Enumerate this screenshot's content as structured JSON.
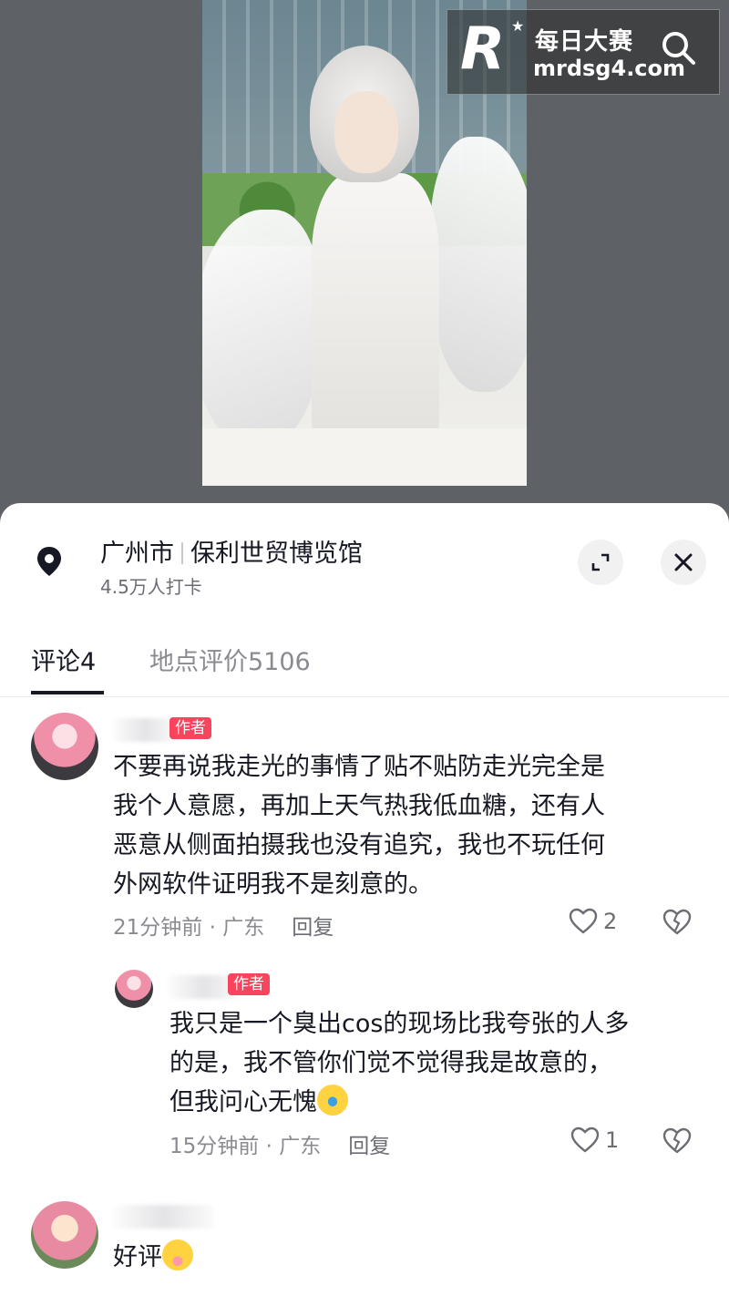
{
  "watermark": {
    "logo_letter": "R",
    "title": "每日大赛",
    "url": "mrdsg4.com"
  },
  "location": {
    "city": "广州市",
    "venue": "保利世贸博览馆",
    "checkins": "4.5万人打卡"
  },
  "tabs": [
    {
      "label": "评论4",
      "active": true
    },
    {
      "label": "地点评价5106",
      "active": false
    }
  ],
  "comments": [
    {
      "badge": "作者",
      "text_lines": [
        "不要再说我走光的事情了贴不贴防走光完全是",
        "我个人意愿，再加上天气热我低血糖，还有人",
        "恶意从侧面拍摄我也没有追究，我也不玩任何",
        "外网软件证明我不是刻意的。"
      ],
      "time": "21分钟前 · 广东",
      "reply_label": "回复",
      "likes": "2"
    },
    {
      "badge": "作者",
      "text_lines": [
        "我只是一个臭出cos的现场比我夸张的人多",
        "的是，我不管你们觉不觉得我是故意的，",
        "但我问心无愧"
      ],
      "time": "15分钟前 · 广东",
      "reply_label": "回复",
      "likes": "1"
    },
    {
      "text_lines": [
        "好评"
      ]
    }
  ],
  "colors": {
    "accent": "#f8445c",
    "text": "#161823",
    "muted": "#8a8b91"
  }
}
